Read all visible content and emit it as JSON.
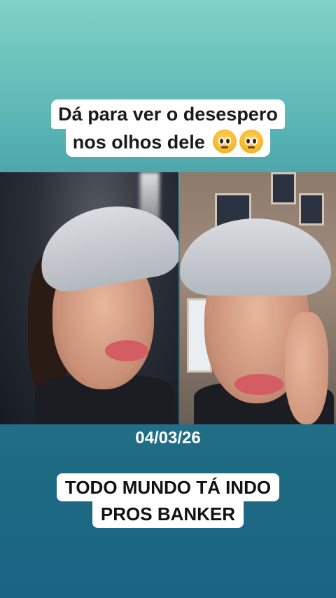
{
  "top_caption": {
    "line1": "Dá para ver o desespero",
    "line2": "nos olhos dele",
    "emoji_icon": "pleading-face-icon"
  },
  "date_text": "04/03/26",
  "bottom_caption": {
    "line1": "TODO MUNDO TÁ INDO",
    "line2": "PROS BANKER"
  },
  "colors": {
    "bg_top": "#7fd2c6",
    "bg_bottom": "#1c6484",
    "caption_bg": "#ffffff"
  }
}
